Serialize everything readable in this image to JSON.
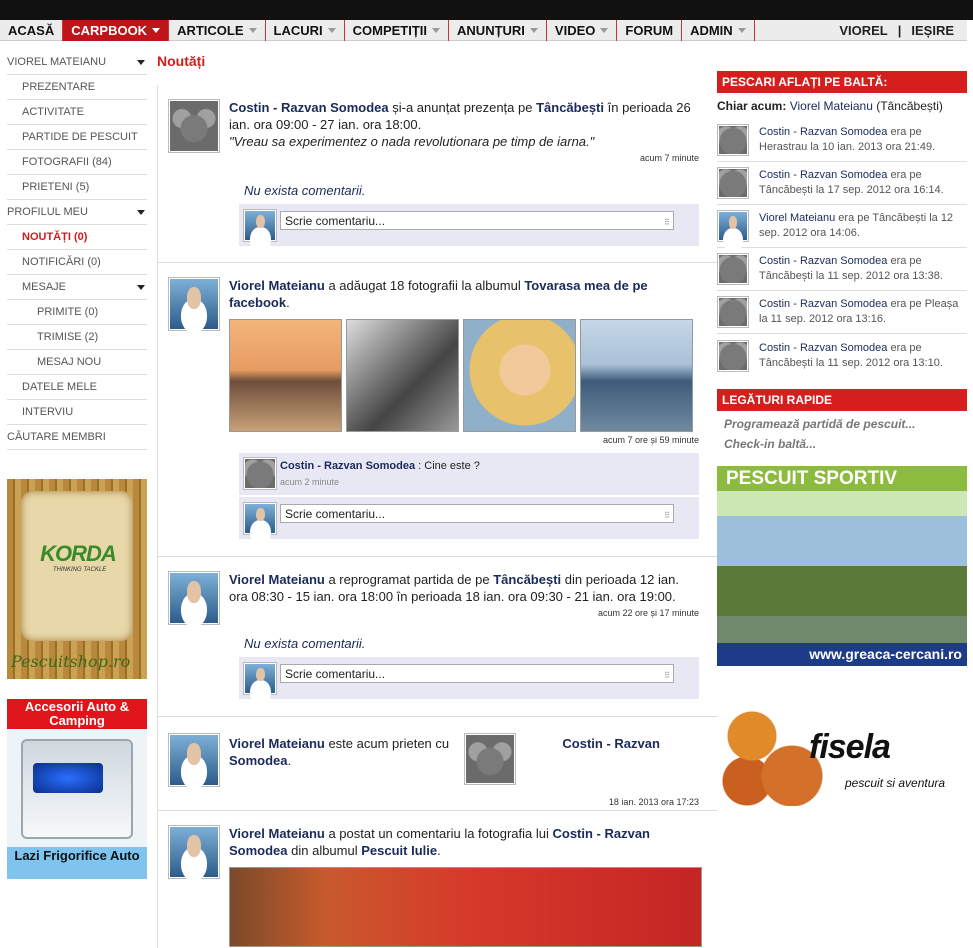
{
  "nav": {
    "items": [
      {
        "label": "ACASĂ",
        "caret": false
      },
      {
        "label": "CARPBOOK",
        "caret": true,
        "active": true
      },
      {
        "label": "ARTICOLE",
        "caret": true
      },
      {
        "label": "LACURI",
        "caret": true
      },
      {
        "label": "COMPETIȚII",
        "caret": true
      },
      {
        "label": "ANUNȚURI",
        "caret": true
      },
      {
        "label": "VIDEO",
        "caret": true
      },
      {
        "label": "FORUM",
        "caret": false
      },
      {
        "label": "ADMIN",
        "caret": true
      }
    ],
    "user": "VIOREL",
    "sep": "|",
    "logout": "IEȘIRE"
  },
  "sidebar": {
    "profile_header": "VIOREL MATEIANU",
    "items": [
      {
        "label": "PREZENTARE",
        "level": 1
      },
      {
        "label": "ACTIVITATE",
        "level": 1
      },
      {
        "label": "PARTIDE DE PESCUIT",
        "level": 1
      },
      {
        "label": "FOTOGRAFII (84)",
        "level": 1
      },
      {
        "label": "PRIETENI (5)",
        "level": 1
      }
    ],
    "my_profile_header": "PROFILUL MEU",
    "my_items": [
      {
        "label": "NOUTĂȚI (0)",
        "level": 1,
        "current": true
      },
      {
        "label": "NOTIFICĂRI (0)",
        "level": 1
      }
    ],
    "messages_header": "MESAJE",
    "message_items": [
      {
        "label": "PRIMITE (0)",
        "level": 2
      },
      {
        "label": "TRIMISE (2)",
        "level": 2
      },
      {
        "label": "MESAJ NOU",
        "level": 2
      }
    ],
    "extra_items": [
      {
        "label": "DATELE MELE",
        "level": 1
      },
      {
        "label": "INTERVIU",
        "level": 1
      }
    ],
    "search": "CĂUTARE MEMBRI",
    "ad1": {
      "logo": "KORDA",
      "sub": "THINKING TACKLE",
      "shop": "Pescuitshop.ro"
    },
    "ad2": {
      "top": "Accesorii Auto & Camping",
      "bottom": "Lazi Frigorifice Auto"
    }
  },
  "main": {
    "title": "Noutăți",
    "comment_placeholder": "Scrie comentariu...",
    "no_comments": "Nu exista comentarii.",
    "posts": [
      {
        "author": "Costin - Razvan Somodea",
        "text1": " și-a anunțat prezența pe ",
        "place": "Tâncăbești",
        "text2": " în perioada 26 ian. ora 09:00 - 27 ian. ora 18:00.",
        "quote": "\"Vreau sa experimentez o nada revolutionara pe timp de iarna.\"",
        "time": "acum 7 minute"
      },
      {
        "author": "Viorel Mateianu",
        "text1": " a adăugat 18 fotografii la albumul ",
        "album": "Tovarasa mea de pe facebook",
        "text2": ".",
        "time": "acum 7 ore și 59 minute",
        "reply_author": "Costin - Razvan Somodea",
        "reply_text": " : Cine este ?",
        "reply_time": "acum 2 minute"
      },
      {
        "author": "Viorel Mateianu",
        "text1": " a reprogramat partida de pe ",
        "place": "Tâncăbești",
        "text2": " din perioada 12 ian. ora 08:30 - 15 ian. ora 18:00 în perioada 18 ian. ora 09:30 - 21 ian. ora 19:00.",
        "time": "acum 22 ore și 17 minute"
      },
      {
        "author": "Viorel Mateianu",
        "text1": " este acum prieten cu",
        "friend": "Costin - Razvan Somodea",
        "text2": ".",
        "time": "18 ian. 2013 ora 17:23"
      },
      {
        "author": "Viorel Mateianu",
        "text1": " a postat un comentariu la fotografia lui ",
        "friend": "Costin - Razvan Somodea",
        "text2": " din albumul ",
        "album": "Pescuit Iulie",
        "text3": "."
      }
    ]
  },
  "right": {
    "now_header": "PESCARI AFLAȚI PE BALTĂ:",
    "now_label": "Chiar acum:",
    "now_name": "Viorel Mateianu",
    "now_place": " (Tâncăbești)",
    "items": [
      {
        "name": "Costin - Razvan Somodea",
        "text": " era pe Herastrau la 10 ian. 2013 ora 21:49.",
        "avatar": "koala"
      },
      {
        "name": "Costin - Razvan Somodea",
        "text": " era pe Tâncăbești la 17 sep. 2012 ora 16:14.",
        "avatar": "koala"
      },
      {
        "name": "Viorel Mateianu",
        "text": " era pe Tâncăbești la 12 sep. 2012 ora 14:06.",
        "avatar": "viorel"
      },
      {
        "name": "Costin - Razvan Somodea",
        "text": " era pe Tâncăbești la 11 sep. 2012 ora 13:38.",
        "avatar": "koala"
      },
      {
        "name": "Costin - Razvan Somodea",
        "text": " era pe Pleașa la 11 sep. 2012 ora 13:16.",
        "avatar": "koala"
      },
      {
        "name": "Costin - Razvan Somodea",
        "text": " era pe Tâncăbești la 11 sep. 2012 ora 13:10.",
        "avatar": "koala"
      }
    ],
    "links_header": "LEGĂTURI RAPIDE",
    "links": [
      "Programează partidă de pescuit...",
      "Check-in baltă..."
    ],
    "ad1": {
      "title": "PESCUIT SPORTIV",
      "url": "www.greaca-cercani.ro"
    },
    "ad2": {
      "logo": "fisela",
      "sub": "pescuit si aventura"
    }
  }
}
